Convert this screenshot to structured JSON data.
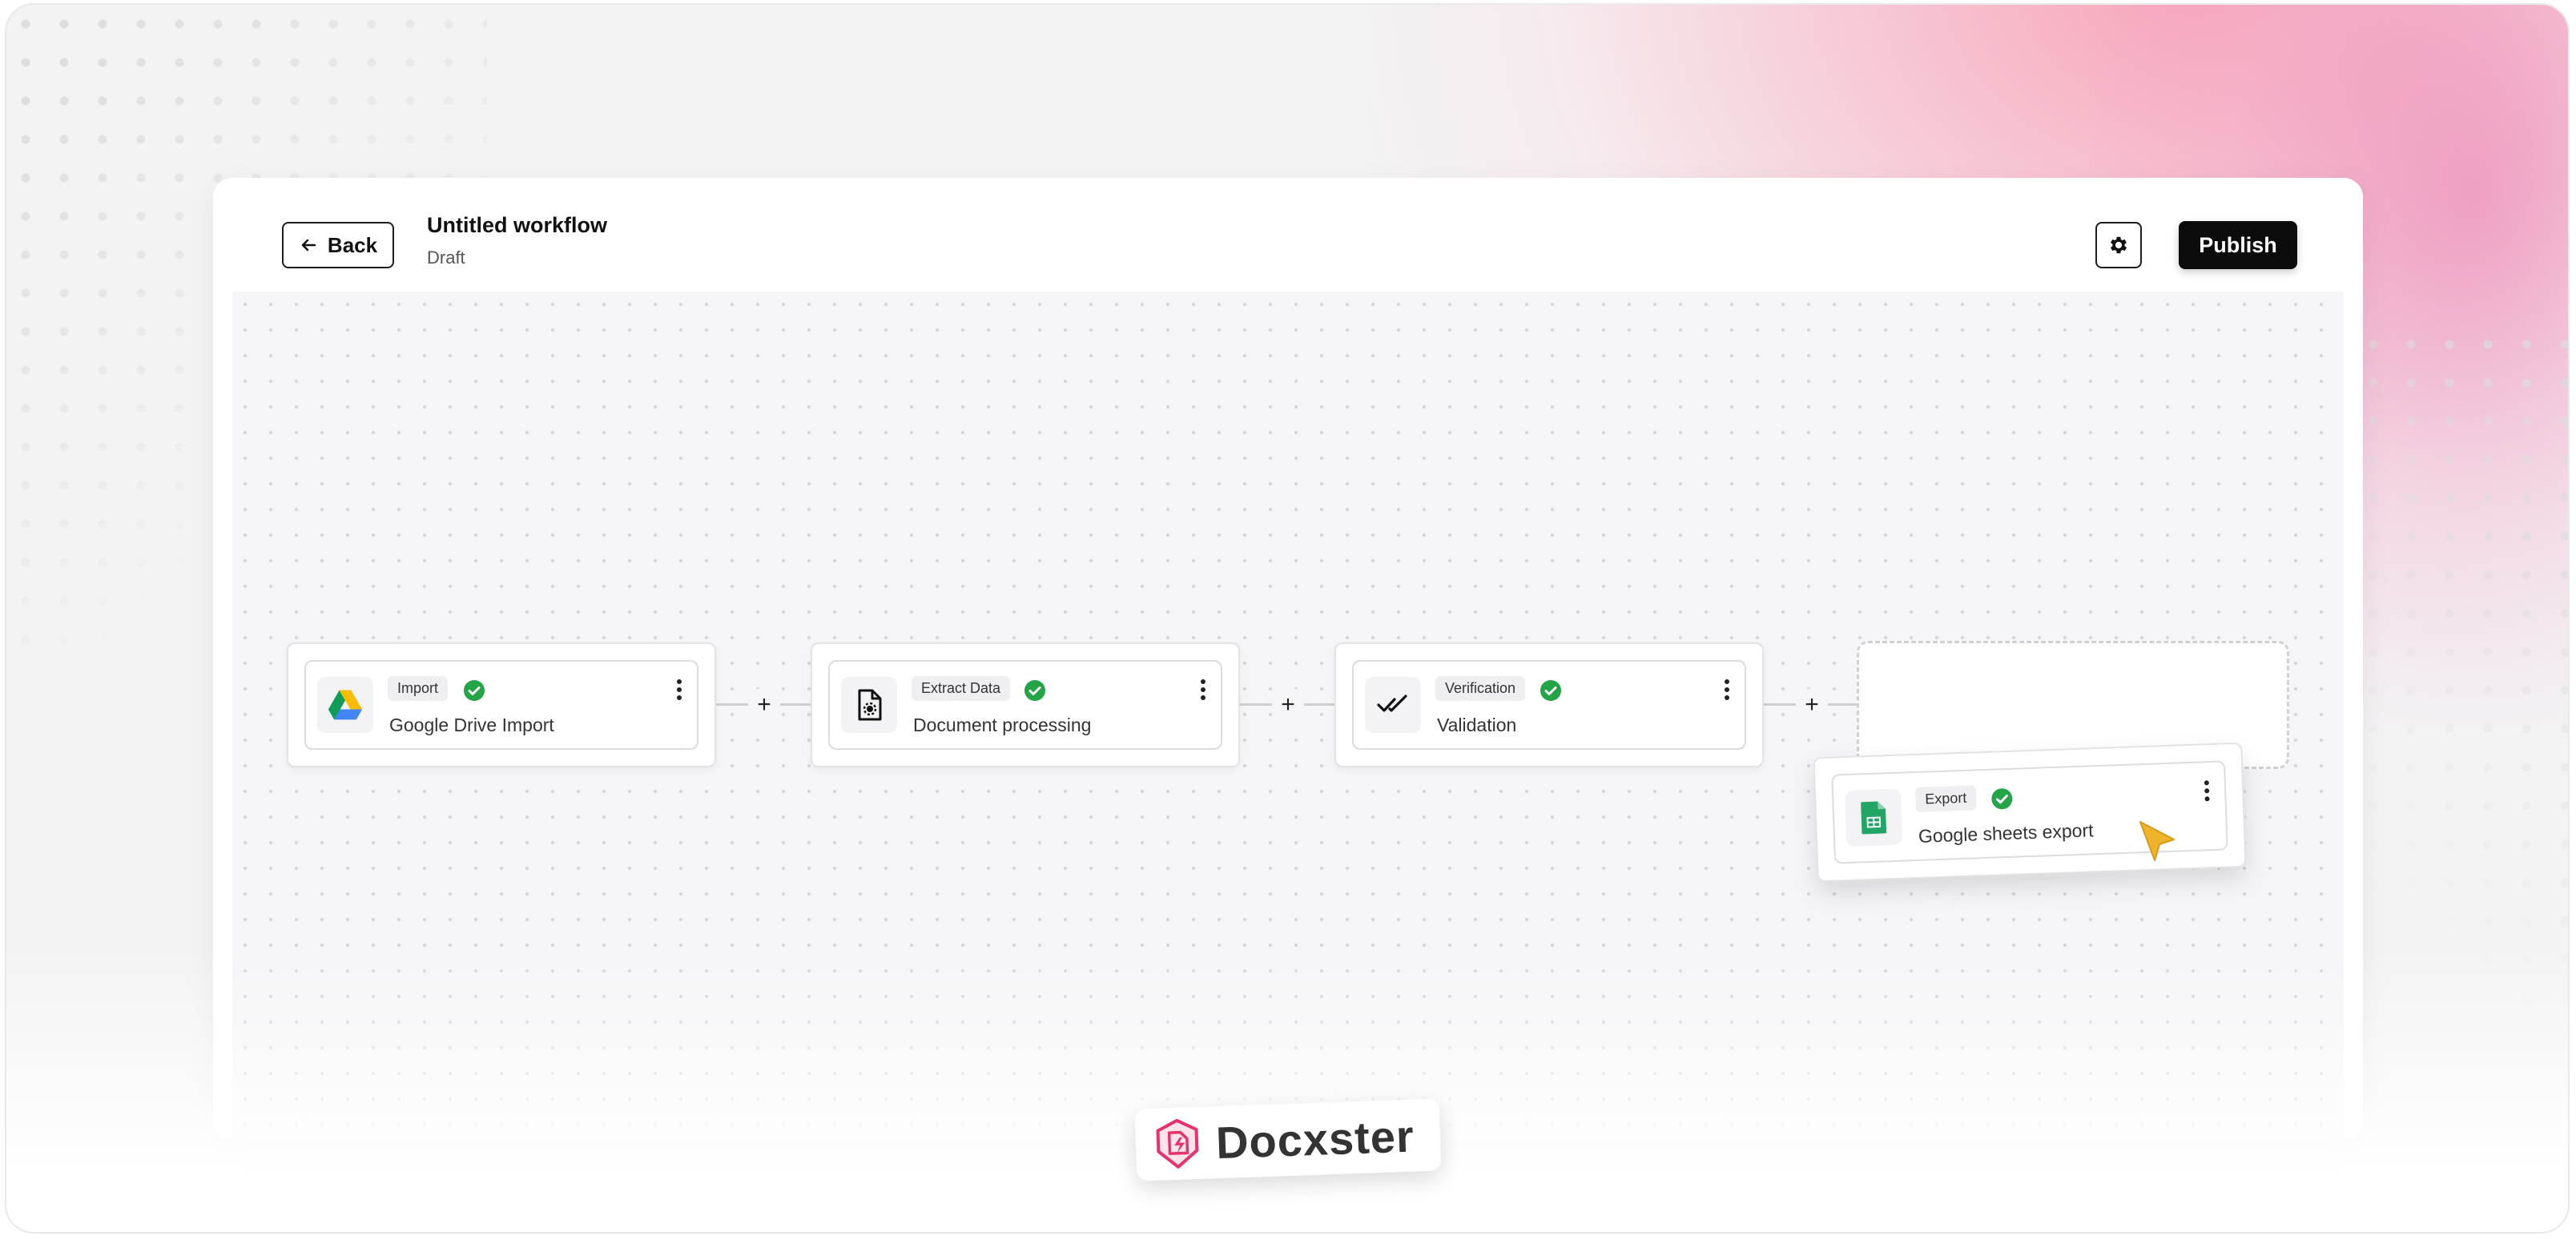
{
  "header": {
    "back_label": "Back",
    "workflow_title": "Untitled workflow",
    "workflow_status": "Draft",
    "publish_label": "Publish"
  },
  "nodes": [
    {
      "tag": "Import",
      "label": "Google Drive Import",
      "icon": "google-drive-icon"
    },
    {
      "tag": "Extract Data",
      "label": "Document processing",
      "icon": "document-gear-icon"
    },
    {
      "tag": "Verification",
      "label": "Validation",
      "icon": "double-check-icon"
    },
    {
      "tag": "Export",
      "label": "Google sheets export",
      "icon": "google-sheets-icon"
    }
  ],
  "connectors": {
    "symbol": "+"
  },
  "brand": {
    "name": "Docxster"
  },
  "colors": {
    "check_green": "#22a447",
    "publish_bg": "#0c0c0d",
    "cursor": "#f0b42a",
    "brand_pink": "#e8326b"
  }
}
